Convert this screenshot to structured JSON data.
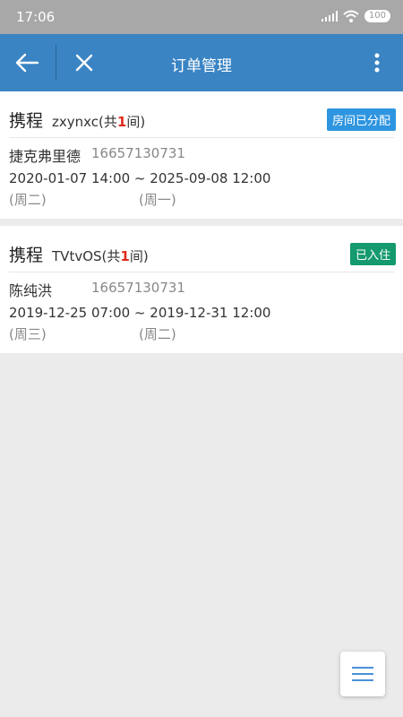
{
  "status": {
    "time": "17:06",
    "battery": "100"
  },
  "header": {
    "title": "订单管理"
  },
  "orders": [
    {
      "source": "携程",
      "hotel": "zxynxc",
      "count_prefix": "(共",
      "count": "1",
      "count_suffix": "间)",
      "badge": "房间已分配",
      "guest": "捷克弗里德",
      "phone": "16657130731",
      "dates": "2020-01-07 14:00 ~ 2025-09-08 12:00",
      "checkin_weekday": "(周二)",
      "checkout_weekday": "(周一)"
    },
    {
      "source": "携程",
      "hotel": "TVtvOS",
      "count_prefix": "(共",
      "count": "1",
      "count_suffix": "间)",
      "badge": "已入住",
      "guest": "陈纯洪",
      "phone": "16657130731",
      "dates": "2019-12-25 07:00 ~ 2019-12-31 12:00",
      "checkin_weekday": "(周三)",
      "checkout_weekday": "(周二)"
    }
  ],
  "colors": {
    "appbar": "#3a84c4",
    "badge_assigned": "#2e95e0",
    "badge_checked_in": "#149a6e",
    "count_red": "#e02a1c"
  }
}
